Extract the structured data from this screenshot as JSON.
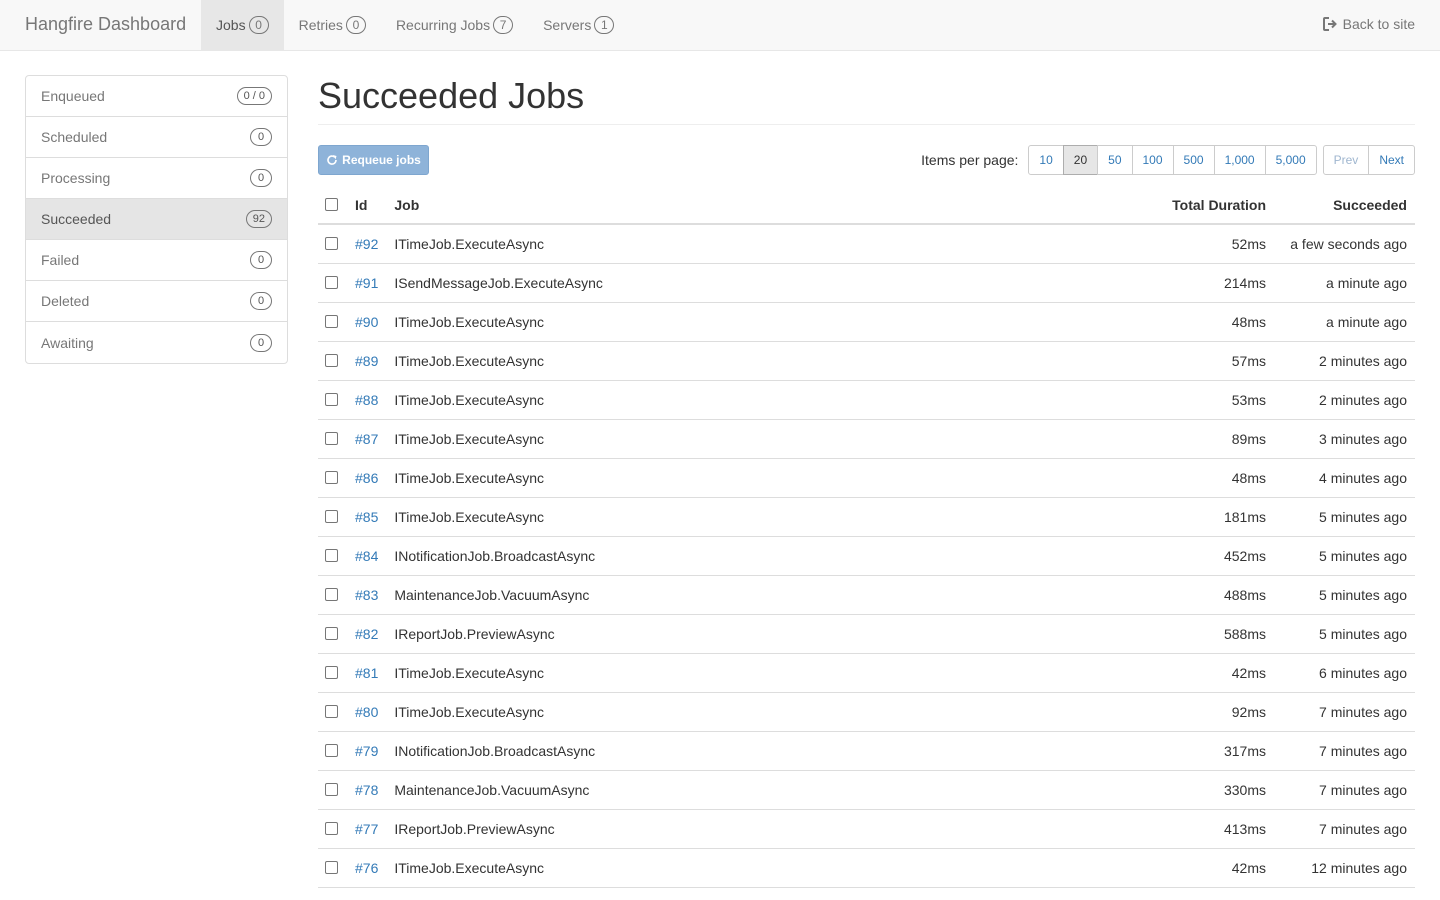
{
  "navbar": {
    "brand": "Hangfire Dashboard",
    "items": [
      {
        "label": "Jobs",
        "count": "0",
        "active": true
      },
      {
        "label": "Retries",
        "count": "0"
      },
      {
        "label": "Recurring Jobs",
        "count": "7"
      },
      {
        "label": "Servers",
        "count": "1"
      }
    ],
    "back_link": "Back to site"
  },
  "sidebar": {
    "items": [
      {
        "label": "Enqueued",
        "count": "0 / 0"
      },
      {
        "label": "Scheduled",
        "count": "0"
      },
      {
        "label": "Processing",
        "count": "0"
      },
      {
        "label": "Succeeded",
        "count": "92",
        "active": true
      },
      {
        "label": "Failed",
        "count": "0"
      },
      {
        "label": "Deleted",
        "count": "0"
      },
      {
        "label": "Awaiting",
        "count": "0"
      }
    ]
  },
  "main": {
    "title": "Succeeded Jobs",
    "requeue_label": "Requeue jobs",
    "items_per_page_label": "Items per page:",
    "page_sizes": [
      "10",
      "20",
      "50",
      "100",
      "500",
      "1,000",
      "5,000"
    ],
    "selected_page_size": "20",
    "prev_label": "Prev",
    "next_label": "Next",
    "columns": {
      "id": "Id",
      "job": "Job",
      "duration": "Total Duration",
      "succeeded": "Succeeded"
    },
    "rows": [
      {
        "id": "#92",
        "job": "ITimeJob.ExecuteAsync",
        "duration": "52ms",
        "succeeded": "a few seconds ago"
      },
      {
        "id": "#91",
        "job": "ISendMessageJob.ExecuteAsync",
        "duration": "214ms",
        "succeeded": "a minute ago"
      },
      {
        "id": "#90",
        "job": "ITimeJob.ExecuteAsync",
        "duration": "48ms",
        "succeeded": "a minute ago"
      },
      {
        "id": "#89",
        "job": "ITimeJob.ExecuteAsync",
        "duration": "57ms",
        "succeeded": "2 minutes ago"
      },
      {
        "id": "#88",
        "job": "ITimeJob.ExecuteAsync",
        "duration": "53ms",
        "succeeded": "2 minutes ago"
      },
      {
        "id": "#87",
        "job": "ITimeJob.ExecuteAsync",
        "duration": "89ms",
        "succeeded": "3 minutes ago"
      },
      {
        "id": "#86",
        "job": "ITimeJob.ExecuteAsync",
        "duration": "48ms",
        "succeeded": "4 minutes ago"
      },
      {
        "id": "#85",
        "job": "ITimeJob.ExecuteAsync",
        "duration": "181ms",
        "succeeded": "5 minutes ago"
      },
      {
        "id": "#84",
        "job": "INotificationJob.BroadcastAsync",
        "duration": "452ms",
        "succeeded": "5 minutes ago"
      },
      {
        "id": "#83",
        "job": "MaintenanceJob.VacuumAsync",
        "duration": "488ms",
        "succeeded": "5 minutes ago"
      },
      {
        "id": "#82",
        "job": "IReportJob.PreviewAsync",
        "duration": "588ms",
        "succeeded": "5 minutes ago"
      },
      {
        "id": "#81",
        "job": "ITimeJob.ExecuteAsync",
        "duration": "42ms",
        "succeeded": "6 minutes ago"
      },
      {
        "id": "#80",
        "job": "ITimeJob.ExecuteAsync",
        "duration": "92ms",
        "succeeded": "7 minutes ago"
      },
      {
        "id": "#79",
        "job": "INotificationJob.BroadcastAsync",
        "duration": "317ms",
        "succeeded": "7 minutes ago"
      },
      {
        "id": "#78",
        "job": "MaintenanceJob.VacuumAsync",
        "duration": "330ms",
        "succeeded": "7 minutes ago"
      },
      {
        "id": "#77",
        "job": "IReportJob.PreviewAsync",
        "duration": "413ms",
        "succeeded": "7 minutes ago"
      },
      {
        "id": "#76",
        "job": "ITimeJob.ExecuteAsync",
        "duration": "42ms",
        "succeeded": "12 minutes ago"
      }
    ]
  },
  "icons": {
    "back": "sign-out-icon",
    "requeue": "refresh-icon"
  },
  "colors": {
    "link": "#337ab7",
    "requeue_button": "#8eb3d9",
    "navbar_bg": "#f8f8f8"
  }
}
